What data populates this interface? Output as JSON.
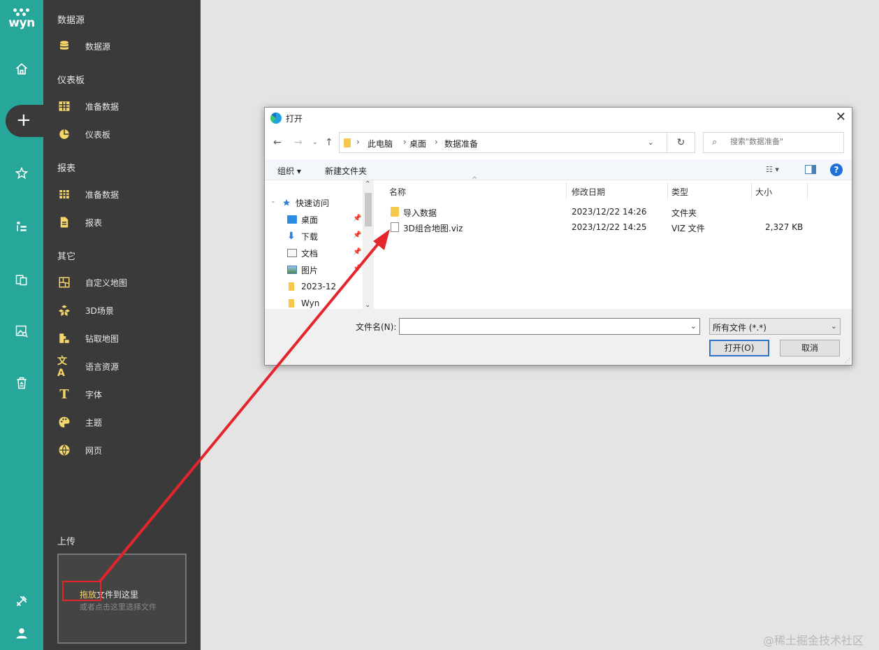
{
  "rail": {
    "logo_text": "wyn",
    "icons": [
      "home-icon",
      "plus-icon",
      "star-icon",
      "hierarchy-icon",
      "documents-icon",
      "image-search-icon",
      "recycle-bin-icon",
      "tools-icon",
      "user-icon"
    ],
    "active": "plus-icon"
  },
  "panel": {
    "sections": [
      {
        "title": "数据源",
        "items": [
          {
            "label": "数据源",
            "icon": "database-icon"
          }
        ]
      },
      {
        "title": "仪表板",
        "items": [
          {
            "label": "准备数据",
            "icon": "table-grid-icon"
          },
          {
            "label": "仪表板",
            "icon": "pie-chart-icon"
          }
        ]
      },
      {
        "title": "报表",
        "items": [
          {
            "label": "准备数据",
            "icon": "table-grid-icon"
          },
          {
            "label": "报表",
            "icon": "report-document-icon"
          }
        ]
      },
      {
        "title": "其它",
        "items": [
          {
            "label": "自定义地图",
            "icon": "custom-map-icon"
          },
          {
            "label": "3D场景",
            "icon": "cubes-icon"
          },
          {
            "label": "钻取地图",
            "icon": "drill-map-icon"
          },
          {
            "label": "语言资源",
            "icon": "translate-icon"
          },
          {
            "label": "字体",
            "icon": "font-icon"
          },
          {
            "label": "主题",
            "icon": "palette-icon"
          },
          {
            "label": "网页",
            "icon": "globe-icon"
          }
        ]
      }
    ],
    "upload": {
      "title": "上传",
      "drop_highlight": "拖放",
      "drop_rest": "文件到这里",
      "drop_hint": "或者点击这里选择文件"
    }
  },
  "dialog": {
    "title": "打开",
    "close": "✕",
    "path": [
      "此电脑",
      "桌面",
      "数据准备"
    ],
    "search_placeholder": "搜索\"数据准备\"",
    "toolbar": {
      "organize": "组织 ▾",
      "new_folder": "新建文件夹",
      "help": "?"
    },
    "tree": [
      {
        "label": "快速访问",
        "icon": "star-icon",
        "pinned": false
      },
      {
        "label": "桌面",
        "icon": "desktop-icon",
        "pinned": true
      },
      {
        "label": "下载",
        "icon": "download-icon",
        "pinned": true
      },
      {
        "label": "文档",
        "icon": "document-icon",
        "pinned": true
      },
      {
        "label": "图片",
        "icon": "picture-icon",
        "pinned": true
      },
      {
        "label": "2023-12",
        "icon": "folder-icon",
        "pinned": false
      },
      {
        "label": "Wyn",
        "icon": "folder-icon",
        "pinned": false
      }
    ],
    "columns": [
      "名称",
      "修改日期",
      "类型",
      "大小"
    ],
    "files": [
      {
        "name": "导入数据",
        "date": "2023/12/22 14:26",
        "type": "文件夹",
        "size": "",
        "icon": "folder-icon"
      },
      {
        "name": "3D组合地图.viz",
        "date": "2023/12/22 14:25",
        "type": "VIZ 文件",
        "size": "2,327 KB",
        "icon": "file-icon"
      }
    ],
    "filename_label": "文件名(N):",
    "filename_value": "",
    "filetype": "所有文件 (*.*)",
    "open_button": "打开(O)",
    "cancel_button": "取消"
  },
  "watermark": "@稀土掘金技术社区",
  "colors": {
    "rail": "#27a69a",
    "panel": "#3a3a3a",
    "icon_yellow": "#f5d66a",
    "arrow_red": "#e3262b"
  }
}
